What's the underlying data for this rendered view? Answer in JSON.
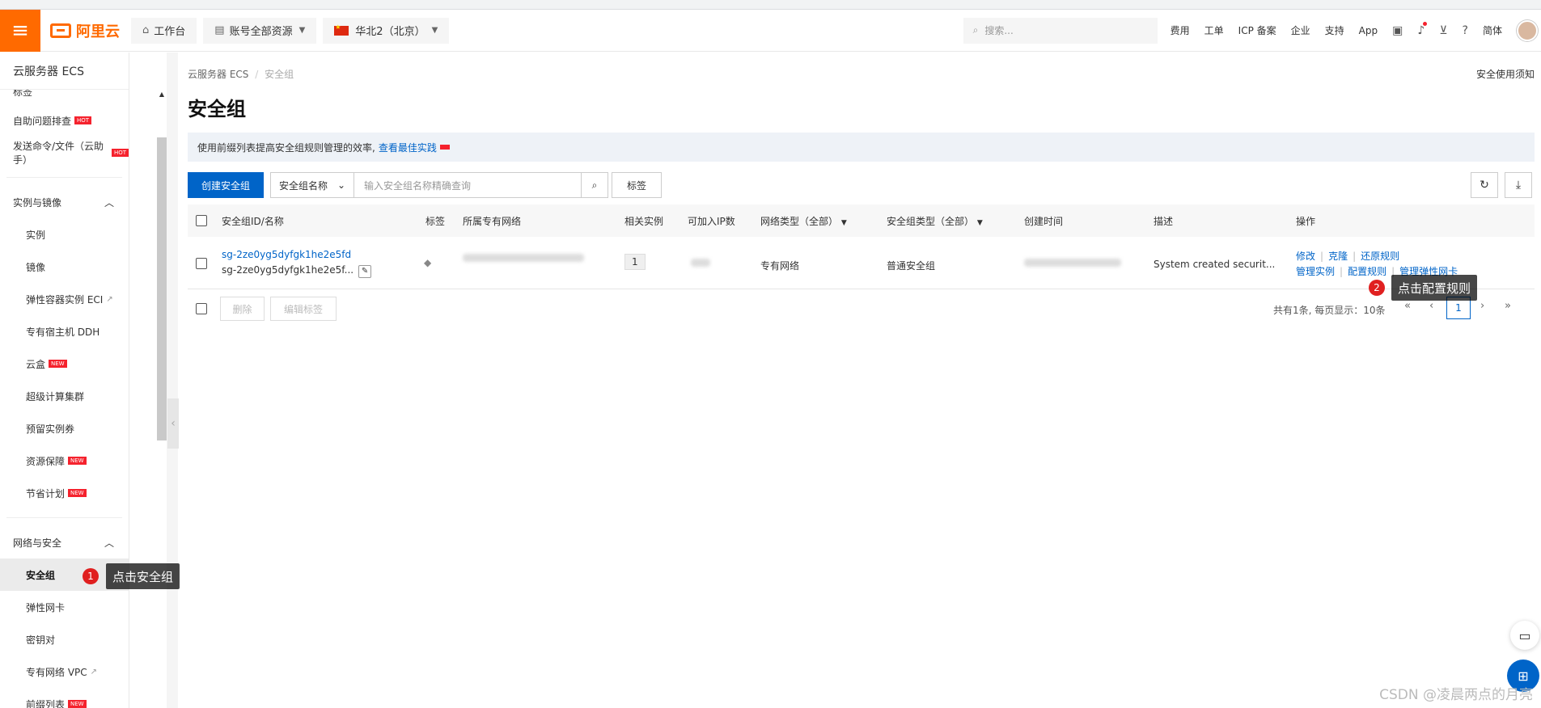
{
  "topbar": {
    "logo_text": "阿里云",
    "workbench": "工作台",
    "account_resources": "账号全部资源",
    "region": "华北2（北京）",
    "search_placeholder": "搜索...",
    "links": [
      "费用",
      "工单",
      "ICP 备案",
      "企业",
      "支持",
      "App"
    ],
    "language": "简体"
  },
  "sidebar": {
    "title": "云服务器 ECS",
    "partial_top": "标签",
    "items_top": [
      {
        "label": "自助问题排查",
        "badge": "HOT"
      },
      {
        "label": "发送命令/文件（云助手）",
        "badge": "HOT"
      }
    ],
    "group_instances": "实例与镜像",
    "instance_items": [
      {
        "label": "实例"
      },
      {
        "label": "镜像"
      },
      {
        "label": "弹性容器实例 ECI"
      },
      {
        "label": "专有宿主机 DDH"
      },
      {
        "label": "云盒",
        "badge": "NEW"
      },
      {
        "label": "超级计算集群"
      },
      {
        "label": "预留实例券"
      },
      {
        "label": "资源保障",
        "badge": "NEW"
      },
      {
        "label": "节省计划",
        "badge": "NEW"
      }
    ],
    "group_network": "网络与安全",
    "network_items": [
      {
        "label": "安全组"
      },
      {
        "label": "弹性网卡"
      },
      {
        "label": "密钥对"
      },
      {
        "label": "专有网络 VPC"
      },
      {
        "label": "前缀列表",
        "badge": "NEW"
      }
    ]
  },
  "main": {
    "breadcrumb": [
      "云服务器 ECS",
      "安全组"
    ],
    "usage_notice": "安全使用须知",
    "title": "安全组",
    "info_text": "使用前缀列表提高安全组规则管理的效率,",
    "info_link": "查看最佳实践",
    "create_button": "创建安全组",
    "filter_select": "安全组名称",
    "search_placeholder": "输入安全组名称精确查询",
    "tag_button": "标签",
    "columns": [
      "安全组ID/名称",
      "标签",
      "所属专有网络",
      "相关实例",
      "可加入IP数",
      "网络类型（全部）",
      "安全组类型（全部）",
      "创建时间",
      "描述",
      "操作"
    ],
    "row": {
      "id": "sg-2ze0yg5dyfgk1he2e5fd",
      "name": "sg-2ze0yg5dyfgk1he2e5f...",
      "instances": "1",
      "network_type": "专有网络",
      "sg_type": "普通安全组",
      "description": "System created securit...",
      "actions_line1": [
        "修改",
        "克隆",
        "还原规则"
      ],
      "actions_line2": [
        "管理实例",
        "配置规则",
        "管理弹性网卡"
      ]
    },
    "delete_button": "删除",
    "edit_tags_button": "编辑标签",
    "pager_text": "共有1条, 每页显示：10条",
    "current_page": "1"
  },
  "annotations": {
    "tip1_num": "1",
    "tip1_text": "点击安全组",
    "tip2_num": "2",
    "tip2_text": "点击配置规则"
  },
  "watermark": "CSDN @凌晨两点的月亮"
}
